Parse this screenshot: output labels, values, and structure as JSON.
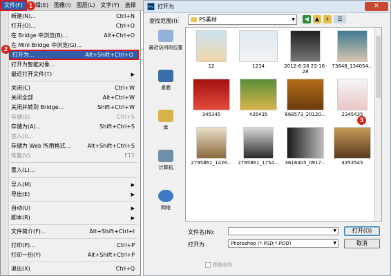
{
  "menubar": {
    "items": [
      "文件(F)",
      "编辑(E)",
      "图像(I)",
      "图层(L)",
      "文字(Y)",
      "选择"
    ]
  },
  "file_menu": {
    "items": [
      {
        "label": "新建(N)...",
        "shortcut": "Ctrl+N"
      },
      {
        "label": "打开(O)...",
        "shortcut": "Ctrl+O"
      },
      {
        "label": "在 Bridge 中浏览(B)...",
        "shortcut": "Alt+Ctrl+O"
      },
      {
        "label": "在 Mini Bridge 中浏览(G)...",
        "shortcut": ""
      },
      {
        "label": "打开为...",
        "shortcut": "Alt+Shift+Ctrl+O"
      },
      {
        "label": "打开为智能对象...",
        "shortcut": ""
      },
      {
        "label": "最近打开文件(T)",
        "shortcut": ""
      },
      {
        "label": "关闭(C)",
        "shortcut": "Ctrl+W"
      },
      {
        "label": "关闭全部",
        "shortcut": "Alt+Ctrl+W"
      },
      {
        "label": "关闭并转到 Bridge...",
        "shortcut": "Shift+Ctrl+W"
      },
      {
        "label": "存储(S)",
        "shortcut": "Ctrl+S"
      },
      {
        "label": "存储为(A)...",
        "shortcut": "Shift+Ctrl+S"
      },
      {
        "label": "签入(I)...",
        "shortcut": ""
      },
      {
        "label": "存储为 Web 所用格式...",
        "shortcut": "Alt+Shift+Ctrl+S"
      },
      {
        "label": "恢复(V)",
        "shortcut": "F12"
      },
      {
        "label": "置入(L)...",
        "shortcut": ""
      },
      {
        "label": "导入(M)",
        "shortcut": ""
      },
      {
        "label": "导出(E)",
        "shortcut": ""
      },
      {
        "label": "自动(U)",
        "shortcut": ""
      },
      {
        "label": "脚本(R)",
        "shortcut": ""
      },
      {
        "label": "文件简介(F)...",
        "shortcut": "Alt+Shift+Ctrl+I"
      },
      {
        "label": "打印(P)...",
        "shortcut": "Ctrl+P"
      },
      {
        "label": "打印一份(Y)",
        "shortcut": "Alt+Shift+Ctrl+P"
      },
      {
        "label": "退出(X)",
        "shortcut": "Ctrl+Q"
      }
    ]
  },
  "badges": [
    "1",
    "2",
    "3"
  ],
  "dialog": {
    "title": "打开为",
    "close_label": "✕",
    "look_in_label": "查找范围(I):",
    "look_in_value": "PS素材",
    "places": [
      "最近访问的位置",
      "桌面",
      "库",
      "计算机",
      "网络"
    ],
    "files": [
      {
        "name": "12"
      },
      {
        "name": "1234"
      },
      {
        "name": "2012-6-28 23-16-28"
      },
      {
        "name": "73648_134054..."
      },
      {
        "name": "345345"
      },
      {
        "name": "435435"
      },
      {
        "name": "668573_20120..."
      },
      {
        "name": "2345435"
      },
      {
        "name": "2795861_1426..."
      },
      {
        "name": "2795861_1754..."
      },
      {
        "name": "3618405_0917..."
      },
      {
        "name": "4353545"
      }
    ],
    "filename_label": "文件名(N):",
    "filename_value": "",
    "open_as_label": "打开为",
    "open_as_value": "Photoshop (*.PSD;*.PDD)",
    "open_button": "打开(O)",
    "cancel_button": "取消",
    "sequence_label": "图像序列"
  }
}
